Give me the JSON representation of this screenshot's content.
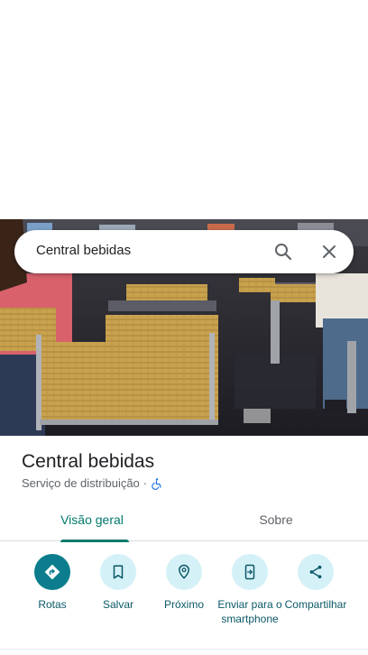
{
  "search": {
    "query": "Central bebidas"
  },
  "place": {
    "title": "Central bebidas",
    "category": "Serviço de distribuição",
    "separator": "·"
  },
  "tabs": [
    {
      "label": "Visão geral",
      "active": true
    },
    {
      "label": "Sobre",
      "active": false
    }
  ],
  "actions": [
    {
      "label": "Rotas",
      "icon": "directions-icon"
    },
    {
      "label": "Salvar",
      "icon": "bookmark-icon"
    },
    {
      "label": "Próximo",
      "icon": "nearby-icon"
    },
    {
      "label": "Enviar para o smartphone",
      "icon": "send-to-phone-icon"
    },
    {
      "label": "Compartilhar",
      "icon": "share-icon"
    }
  ],
  "colors": {
    "accent": "#00796b",
    "action_primary": "#0b7d8c",
    "action_bg": "#d5f1f8",
    "wheelchair": "#1a73e8"
  }
}
